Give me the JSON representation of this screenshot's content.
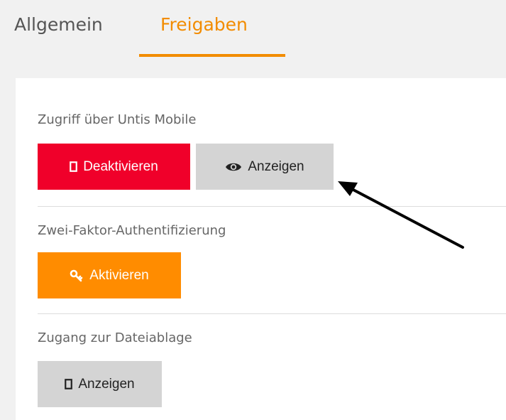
{
  "tabs": [
    {
      "label": "Allgemein",
      "active": false
    },
    {
      "label": "Freigaben",
      "active": true
    }
  ],
  "accent_color": "#f28c00",
  "sections": {
    "mobile": {
      "label": "Zugriff über Untis Mobile",
      "deactivate_label": "Deaktivieren",
      "deactivate_icon": "phone-icon",
      "show_label": "Anzeigen",
      "show_icon": "eye-icon"
    },
    "two_factor": {
      "label": "Zwei-Faktor-Authentifizierung",
      "activate_label": "Aktivieren",
      "activate_icon": "key-icon"
    },
    "file_storage": {
      "label": "Zugang zur Dateiablage",
      "show_label": "Anzeigen",
      "show_icon": "phone-icon"
    }
  },
  "colors": {
    "danger": "#f0002a",
    "warning": "#ff8c00",
    "neutral": "#d4d4d4"
  }
}
